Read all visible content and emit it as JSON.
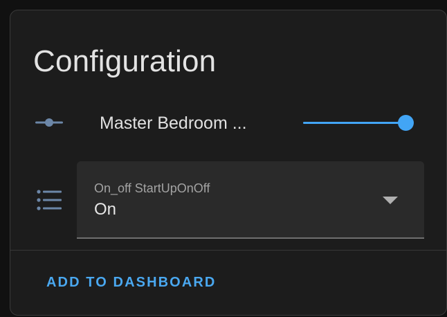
{
  "card": {
    "title": "Configuration"
  },
  "slider_row": {
    "icon": "slider-icon",
    "entity_name": "Master Bedroom ...",
    "value_fraction": 0.95,
    "accent_color": "#42a5f5"
  },
  "select_row": {
    "icon": "format-list-bulleted-icon",
    "label": "On_off StartUpOnOff",
    "value": "On"
  },
  "actions": {
    "add_to_dashboard": "ADD TO DASHBOARD"
  }
}
